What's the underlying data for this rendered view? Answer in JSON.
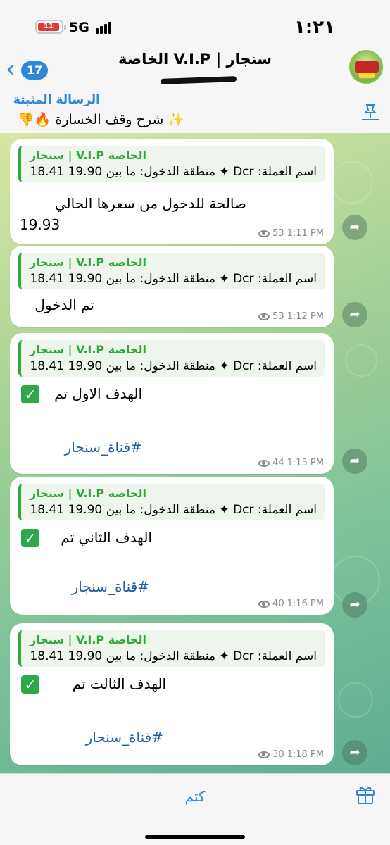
{
  "status_bar": {
    "time": "١:٢١",
    "network": "5G",
    "battery_level": "11"
  },
  "header": {
    "unread_count": "17",
    "title": "سنجار | V.I.P الخاصة"
  },
  "pinned": {
    "title": "الرسالة المثبتة",
    "text": "✨ شرح وقف الخسارة 🔥👎"
  },
  "messages": [
    {
      "reply_title": "سنجار | V.I.P الخاصة",
      "reply_line": "اسم العملة: Dcr ✦ منطقة الدخول: ما بين 19.90 18.41",
      "line1": "صالحة للدخول من سعرها الحالي",
      "line2": "19.93",
      "hashtag": "",
      "views": "53",
      "time": "1:11 PM"
    },
    {
      "reply_title": "سنجار | V.I.P الخاصة",
      "reply_line": "اسم العملة: Dcr ✦ منطقة الدخول: ما بين 19.90 18.41",
      "line1": "تم الدخول",
      "line2": "",
      "hashtag": "",
      "views": "53",
      "time": "1:12 PM"
    },
    {
      "reply_title": "سنجار | V.I.P الخاصة",
      "reply_line": "اسم العملة: Dcr ✦ منطقة الدخول: ما بين 19.90 18.41",
      "line1": "الهدف الاول   تم",
      "line2": "",
      "hashtag": "#قناة_سنجار",
      "views": "44",
      "time": "1:15 PM"
    },
    {
      "reply_title": "سنجار | V.I.P الخاصة",
      "reply_line": "اسم العملة: Dcr ✦ منطقة الدخول: ما بين 19.90 18.41",
      "line1": "الهدف الثاني    تم",
      "line2": "",
      "hashtag": "#قناة_سنجار",
      "views": "40",
      "time": "1:16 PM"
    },
    {
      "reply_title": "سنجار | V.I.P الخاصة",
      "reply_line": "اسم العملة: Dcr ✦ منطقة الدخول: ما بين 19.90 18.41",
      "line1": "الهدف الثالث     تم",
      "line2": "",
      "hashtag": "#قناة_سنجار",
      "views": "30",
      "time": "1:18 PM"
    }
  ],
  "bottom": {
    "mute_label": "كتم"
  }
}
